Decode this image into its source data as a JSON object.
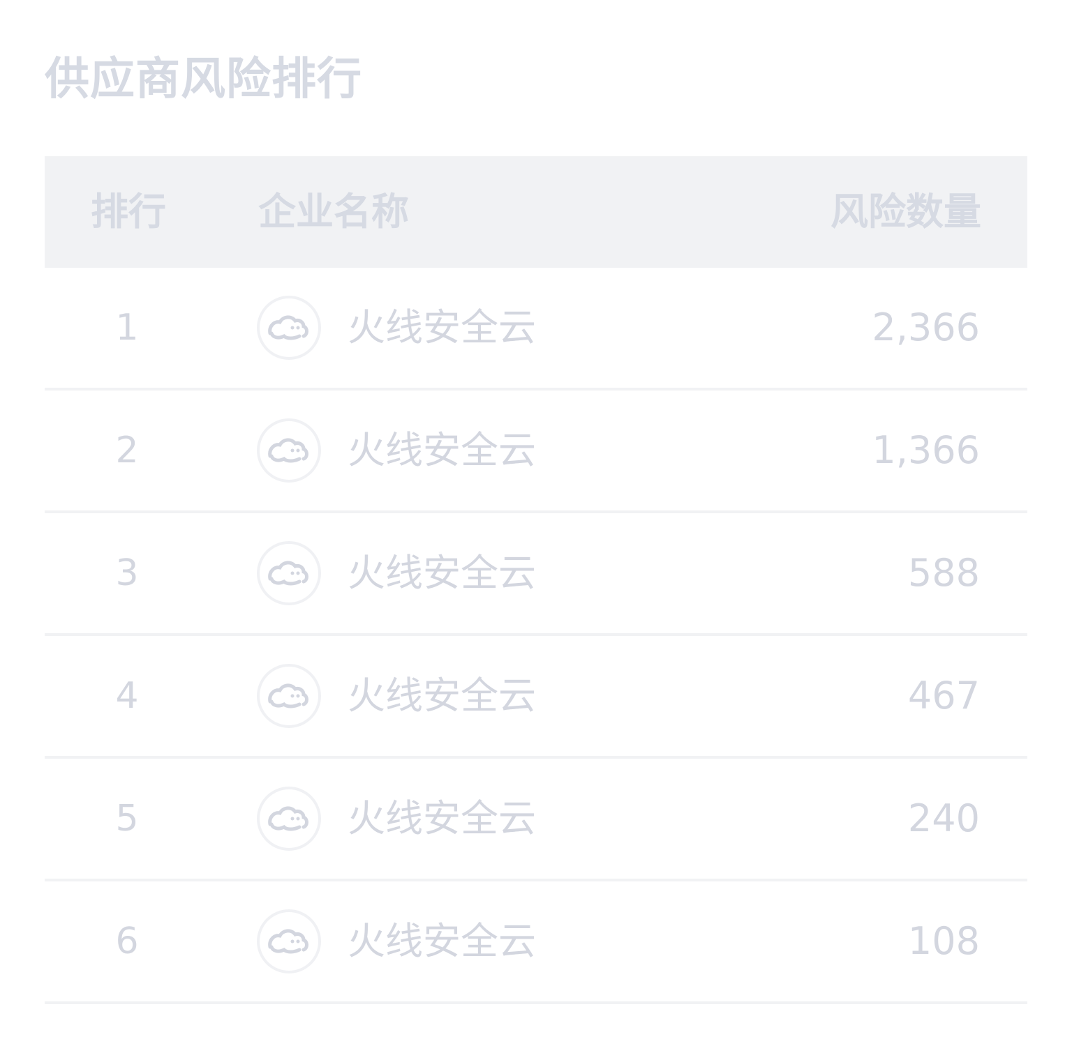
{
  "page_title": "供应商风险排行",
  "table": {
    "headers": {
      "rank": "排行",
      "company": "企业名称",
      "risk_count": "风险数量"
    },
    "rows": [
      {
        "rank": "1",
        "company": "火线安全云",
        "risk_count": "2,366",
        "logo_icon": "cloud-logo-icon"
      },
      {
        "rank": "2",
        "company": "火线安全云",
        "risk_count": "1,366",
        "logo_icon": "cloud-logo-icon"
      },
      {
        "rank": "3",
        "company": "火线安全云",
        "risk_count": "588",
        "logo_icon": "cloud-logo-icon"
      },
      {
        "rank": "4",
        "company": "火线安全云",
        "risk_count": "467",
        "logo_icon": "cloud-logo-icon"
      },
      {
        "rank": "5",
        "company": "火线安全云",
        "risk_count": "240",
        "logo_icon": "cloud-logo-icon"
      },
      {
        "rank": "6",
        "company": "火线安全云",
        "risk_count": "108",
        "logo_icon": "cloud-logo-icon"
      }
    ]
  },
  "colors": {
    "text_muted": "#d3d6df",
    "header_bg": "#f1f2f4",
    "divider": "#f1f2f4"
  }
}
